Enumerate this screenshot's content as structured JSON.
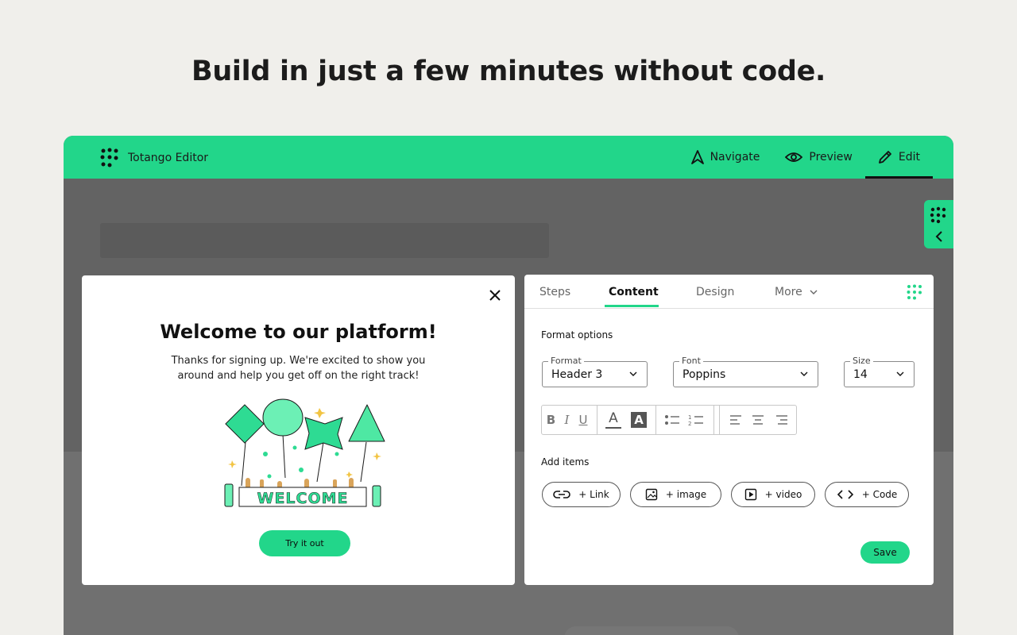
{
  "hero": {
    "title": "Build in just a few minutes without code."
  },
  "topbar": {
    "brand_name": "Totango Editor",
    "nav": [
      {
        "label": "Navigate",
        "icon": "navigate-arrow-icon"
      },
      {
        "label": "Preview",
        "icon": "eye-icon"
      },
      {
        "label": "Edit",
        "icon": "pencil-icon",
        "active": true
      }
    ]
  },
  "modal": {
    "title": "Welcome to our platform!",
    "body": "Thanks for signing up. We're excited to show you around and help you get off on the right track!",
    "illustration_text": "WELCOME",
    "cta_label": "Try it out"
  },
  "panel": {
    "tabs": [
      {
        "label": "Steps",
        "active": false
      },
      {
        "label": "Content",
        "active": true
      },
      {
        "label": "Design",
        "active": false
      },
      {
        "label": "More",
        "active": false
      }
    ],
    "format_section_title": "Format options",
    "fields": {
      "format": {
        "label": "Format",
        "value": "Header 3"
      },
      "font": {
        "label": "Font",
        "value": "Poppins"
      },
      "size": {
        "label": "Size",
        "value": "14"
      }
    },
    "toolbar": {
      "bold": "B",
      "italic": "I",
      "underline": "U",
      "text_color": "A",
      "highlight": "A"
    },
    "add_section_title": "Add items",
    "add_items": [
      {
        "label": "+ Link",
        "icon": "link-icon"
      },
      {
        "label": "+ image",
        "icon": "image-icon"
      },
      {
        "label": "+ video",
        "icon": "video-icon"
      },
      {
        "label": "+ Code",
        "icon": "code-icon"
      }
    ],
    "save_label": "Save"
  },
  "colors": {
    "accent": "#22d68a",
    "page_bg": "#f0efeb",
    "overlay": "#636363"
  }
}
